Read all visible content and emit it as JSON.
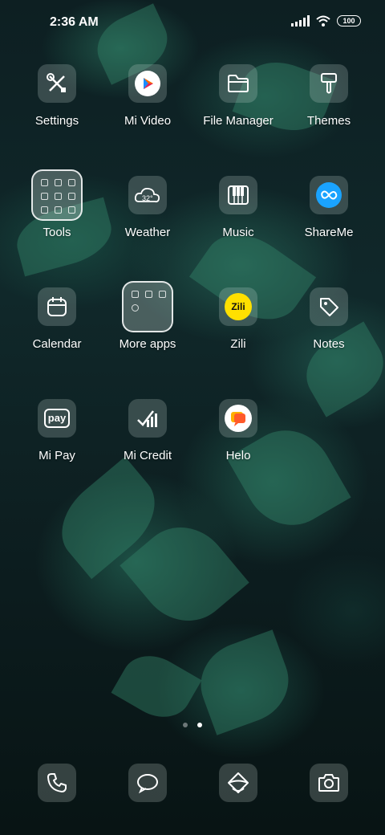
{
  "status_bar": {
    "time": "2:36 AM",
    "battery": "100",
    "icons": [
      "signal-icon",
      "wifi-icon",
      "battery-icon"
    ]
  },
  "apps": [
    {
      "label": "Settings",
      "icon": "settings-icon"
    },
    {
      "label": "Mi Video",
      "icon": "play-icon"
    },
    {
      "label": "File Manager",
      "icon": "folder-icon"
    },
    {
      "label": "Themes",
      "icon": "brush-icon"
    },
    {
      "label": "Tools",
      "icon": "folder-icon"
    },
    {
      "label": "Weather",
      "icon": "cloud-icon",
      "badge": "32°"
    },
    {
      "label": "Music",
      "icon": "piano-icon"
    },
    {
      "label": "ShareMe",
      "icon": "infinity-icon"
    },
    {
      "label": "Calendar",
      "icon": "calendar-icon"
    },
    {
      "label": "More apps",
      "icon": "folder-icon"
    },
    {
      "label": "Zili",
      "icon": "zili-logo",
      "logo_text": "Zili"
    },
    {
      "label": "Notes",
      "icon": "tag-icon"
    },
    {
      "label": "Mi Pay",
      "icon": "pay-icon",
      "logo_text": "pay"
    },
    {
      "label": "Mi Credit",
      "icon": "chart-icon"
    },
    {
      "label": "Helo",
      "icon": "chat-bubble-icon"
    }
  ],
  "page_indicator": {
    "pages": 2,
    "active": 2
  },
  "dock": [
    {
      "icon": "phone-icon"
    },
    {
      "icon": "message-icon"
    },
    {
      "icon": "browser-icon"
    },
    {
      "icon": "camera-icon"
    }
  ],
  "colors": {
    "tile_bg": "rgba(210,225,220,0.22)",
    "shareme_blue": "#1aa3ff",
    "zili_yellow": "#ffe000",
    "helo_orange": "#ff5a2a"
  }
}
